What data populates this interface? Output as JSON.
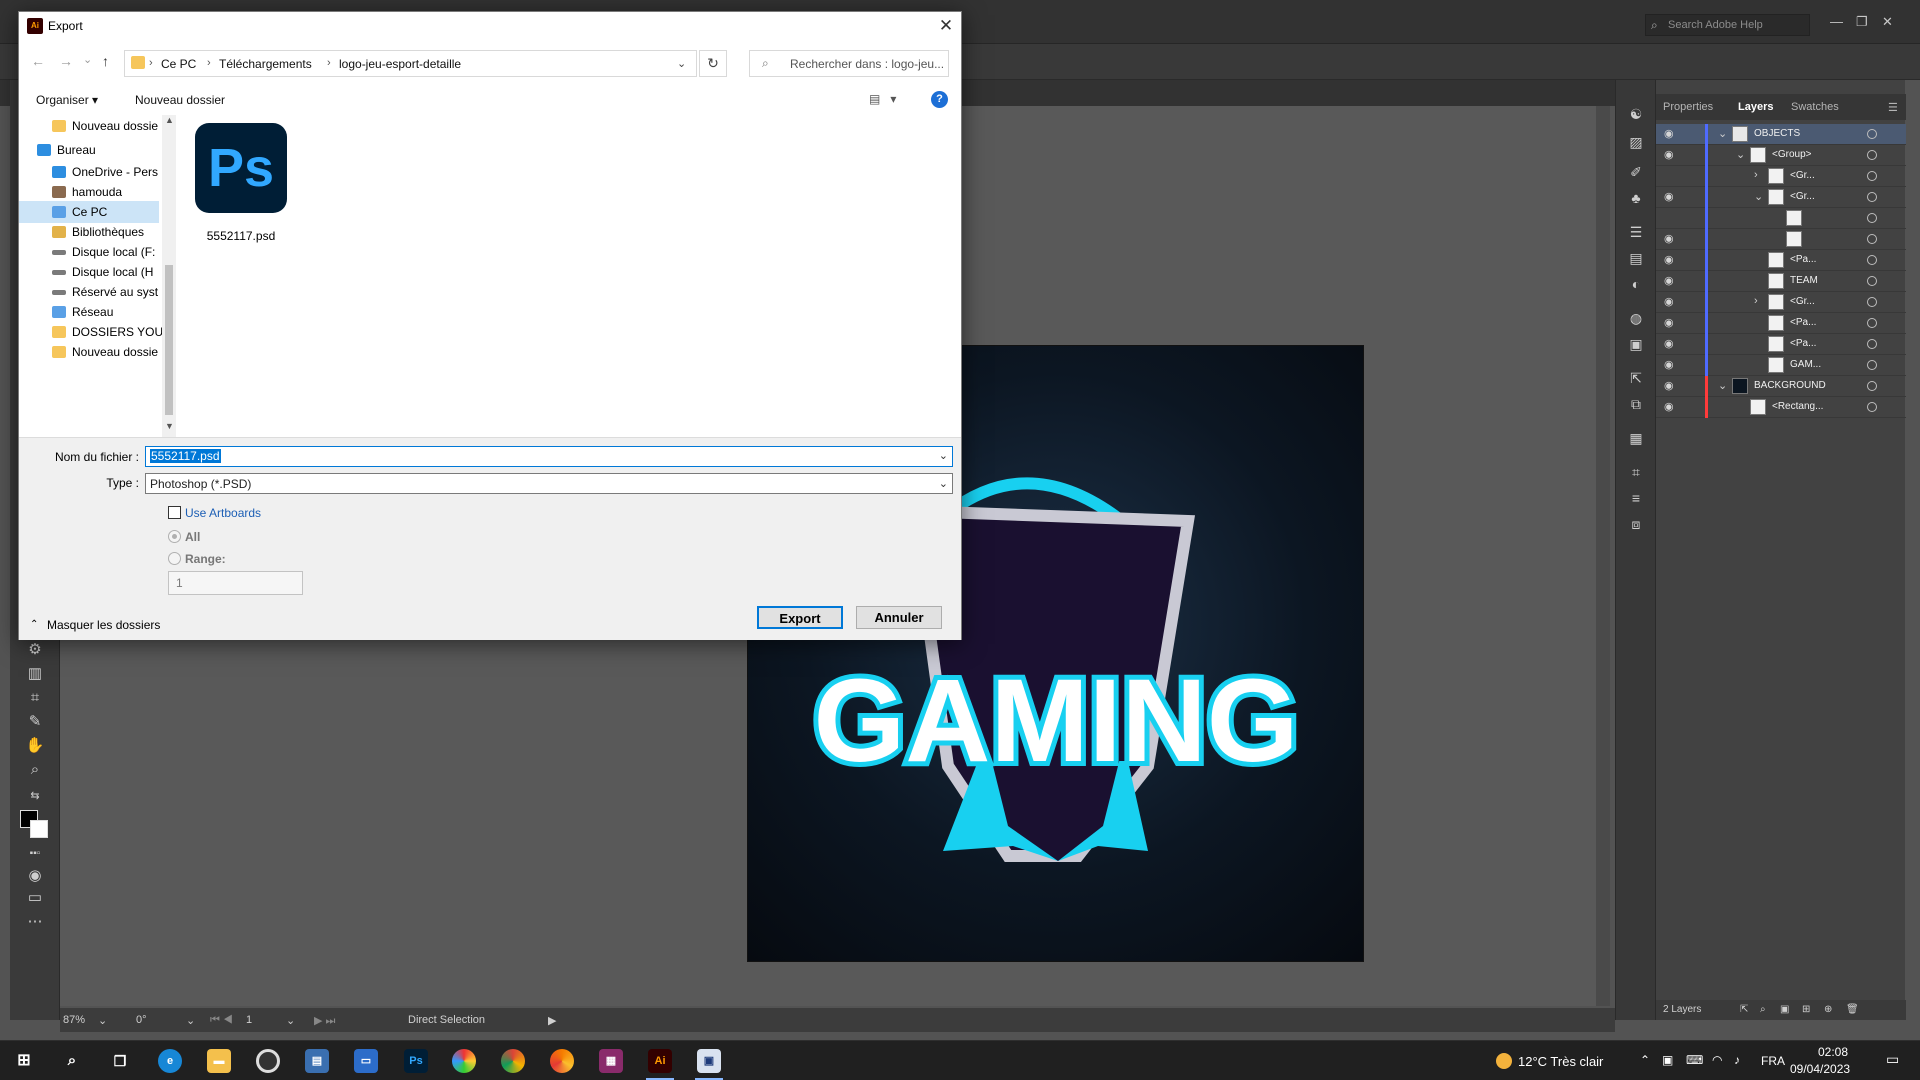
{
  "illustrator": {
    "search_placeholder": "Search Adobe Help",
    "statusbar": {
      "zoom": "87%",
      "rotation": "0°",
      "artboard_number": "1",
      "tool": "Direct Selection"
    },
    "artwork": {
      "headline": "GAMING",
      "colors": {
        "cyan": "#18d0f0",
        "shield": "#1a1030",
        "background": "#0b1520"
      }
    },
    "panel_tabs": [
      "Properties",
      "Layers",
      "Swatches"
    ],
    "layers_count": "2 Layers",
    "layers": [
      {
        "name": "OBJECTS",
        "eye": true,
        "chevron": "down",
        "indent": 0,
        "selected": true,
        "color": "#4f6bff"
      },
      {
        "name": "<Group>",
        "eye": true,
        "chevron": "down",
        "indent": 1,
        "color": "#4f6bff"
      },
      {
        "name": "<Gr...",
        "eye": false,
        "chevron": "right",
        "indent": 2,
        "color": "#4f6bff"
      },
      {
        "name": "<Gr...",
        "eye": true,
        "chevron": "down",
        "indent": 2,
        "color": "#4f6bff"
      },
      {
        "name": "",
        "eye": false,
        "chevron": "",
        "indent": 3,
        "color": "#4f6bff"
      },
      {
        "name": "",
        "eye": true,
        "chevron": "",
        "indent": 3,
        "color": "#4f6bff"
      },
      {
        "name": "<Pa...",
        "eye": true,
        "chevron": "",
        "indent": 2,
        "color": "#4f6bff"
      },
      {
        "name": "TEAM",
        "eye": true,
        "chevron": "",
        "indent": 2,
        "color": "#4f6bff"
      },
      {
        "name": "<Gr...",
        "eye": true,
        "chevron": "right",
        "indent": 2,
        "color": "#4f6bff"
      },
      {
        "name": "<Pa...",
        "eye": true,
        "chevron": "",
        "indent": 2,
        "color": "#4f6bff"
      },
      {
        "name": "<Pa...",
        "eye": true,
        "chevron": "",
        "indent": 2,
        "color": "#4f6bff"
      },
      {
        "name": "GAM...",
        "eye": true,
        "chevron": "",
        "indent": 2,
        "color": "#4f6bff"
      },
      {
        "name": "BACKGROUND",
        "eye": true,
        "chevron": "down",
        "indent": 0,
        "color": "#ff3b3b"
      },
      {
        "name": "<Rectang...",
        "eye": true,
        "chevron": "",
        "indent": 1,
        "color": "#ff3b3b"
      }
    ]
  },
  "dialog": {
    "title": "Export",
    "app_icon_label": "Ai",
    "close_glyph": "✕",
    "nav_arrows": [
      "←",
      "→",
      "⌄",
      "↑"
    ],
    "breadcrumb": [
      "Ce PC",
      "Téléchargements",
      "logo-jeu-esport-detaille"
    ],
    "search_placeholder": "Rechercher dans : logo-jeu...",
    "toolbar": {
      "organize": "Organiser",
      "new_folder": "Nouveau dossier",
      "help": "?"
    },
    "nav_pane": [
      {
        "label": "Nouveau dossie",
        "icon": "folder",
        "indent": 1
      },
      {
        "label": "Bureau",
        "icon": "desktop",
        "indent": 0
      },
      {
        "label": "OneDrive - Pers",
        "icon": "cloud",
        "indent": 1
      },
      {
        "label": "hamouda",
        "icon": "user",
        "indent": 1
      },
      {
        "label": "Ce PC",
        "icon": "computer",
        "indent": 1,
        "selected": true
      },
      {
        "label": "Bibliothèques",
        "icon": "library",
        "indent": 1
      },
      {
        "label": "Disque local (F:",
        "icon": "drive",
        "indent": 1
      },
      {
        "label": "Disque local (H",
        "icon": "drive",
        "indent": 1
      },
      {
        "label": "Réservé au syst",
        "icon": "drive",
        "indent": 1
      },
      {
        "label": "Réseau",
        "icon": "network",
        "indent": 1
      },
      {
        "label": "DOSSIERS YOU",
        "icon": "folder",
        "indent": 1
      },
      {
        "label": "Nouveau dossie",
        "icon": "folder",
        "indent": 1
      }
    ],
    "files": [
      {
        "name": "5552117.psd",
        "icon_label": "Ps"
      }
    ],
    "filename_label": "Nom du fichier :",
    "filename_value": "5552117.psd",
    "type_label": "Type :",
    "type_value": "Photoshop (*.PSD)",
    "use_artboards": {
      "label": "Use Artboards",
      "checked": false
    },
    "all_label": "All",
    "range_label": "Range:",
    "range_value": "1",
    "hide_folders": "Masquer les dossiers",
    "export_button": "Export",
    "cancel_button": "Annuler"
  },
  "taskbar": {
    "weather": "12°C  Très clair",
    "language": "FRA",
    "time": "02:08",
    "date": "09/04/2023"
  }
}
